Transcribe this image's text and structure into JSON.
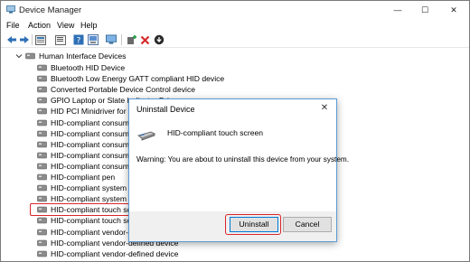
{
  "window": {
    "title": "Device Manager",
    "controls": {
      "minimize": "—",
      "maximize": "☐",
      "close": "✕"
    }
  },
  "menu": [
    "File",
    "Action",
    "View",
    "Help"
  ],
  "toolbar": {
    "buttons": [
      "back-arrow",
      "forward-arrow",
      "device-manager-view",
      "properties",
      "help",
      "scan",
      "monitor",
      "update-driver",
      "uninstall-device",
      "download"
    ]
  },
  "tree": {
    "group": "Human Interface Devices",
    "devices": [
      "Bluetooth HID Device",
      "Bluetooth Low Energy GATT compliant HID device",
      "Converted Portable Device Control device",
      "GPIO Laptop or Slate Indicator Driver",
      "HID PCI Minidriver for ISS",
      "HID-compliant consumer control device",
      "HID-compliant consumer control device",
      "HID-compliant consumer control device",
      "HID-compliant consumer control device",
      "HID-compliant consumer control device",
      "HID-compliant pen",
      "HID-compliant system controller",
      "HID-compliant system controller",
      "HID-compliant touch screen",
      "HID-compliant touch screen",
      "HID-compliant vendor-defined device",
      "HID-compliant vendor-defined device",
      "HID-compliant vendor-defined device",
      "HID-compliant vendor-defined device"
    ],
    "selected_index": 13
  },
  "dialog": {
    "title": "Uninstall Device",
    "close": "✕",
    "device_name": "HID-compliant touch screen",
    "warning": "Warning: You are about to uninstall this device from your system.",
    "uninstall_label": "Uninstall",
    "cancel_label": "Cancel"
  },
  "colors": {
    "highlight_red": "#d9262b",
    "accent_blue": "#0078d7"
  }
}
